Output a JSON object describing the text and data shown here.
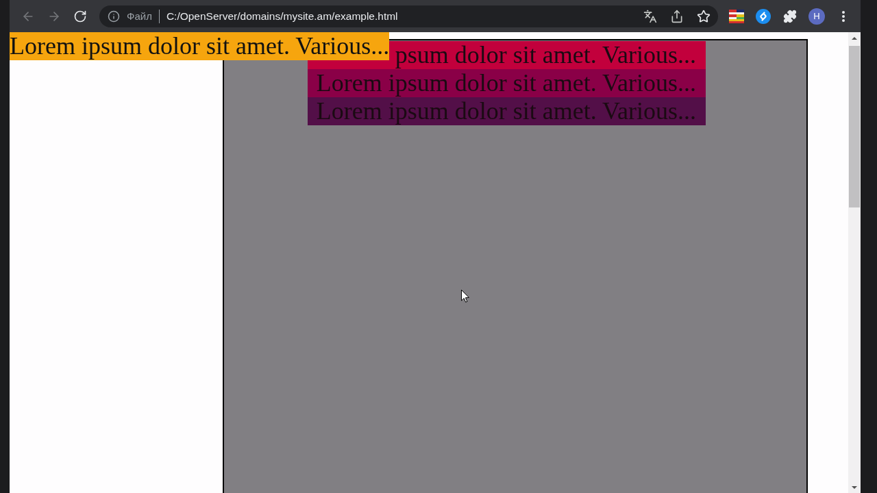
{
  "browser": {
    "nav_buttons": [
      {
        "kind": "back",
        "disabled": true
      },
      {
        "kind": "forward",
        "disabled": true
      },
      {
        "kind": "reload",
        "disabled": false
      }
    ],
    "address_bar": {
      "scheme": "Файл",
      "url": "C:/OpenServer/domains/mysite.am/example.html"
    },
    "profile": {
      "initial": "H"
    }
  },
  "page": {
    "banner": {
      "text": "Lorem ipsum dolor sit amet. Various..."
    },
    "rows": [
      {
        "text": "psum dolor sit amet. Various...",
        "color": "#c2003c"
      },
      {
        "text": "Lorem ipsum dolor sit amet. Various...",
        "color": "#8a0047"
      },
      {
        "text": "Lorem ipsum dolor sit amet. Various...",
        "color": "#530f48"
      }
    ]
  }
}
